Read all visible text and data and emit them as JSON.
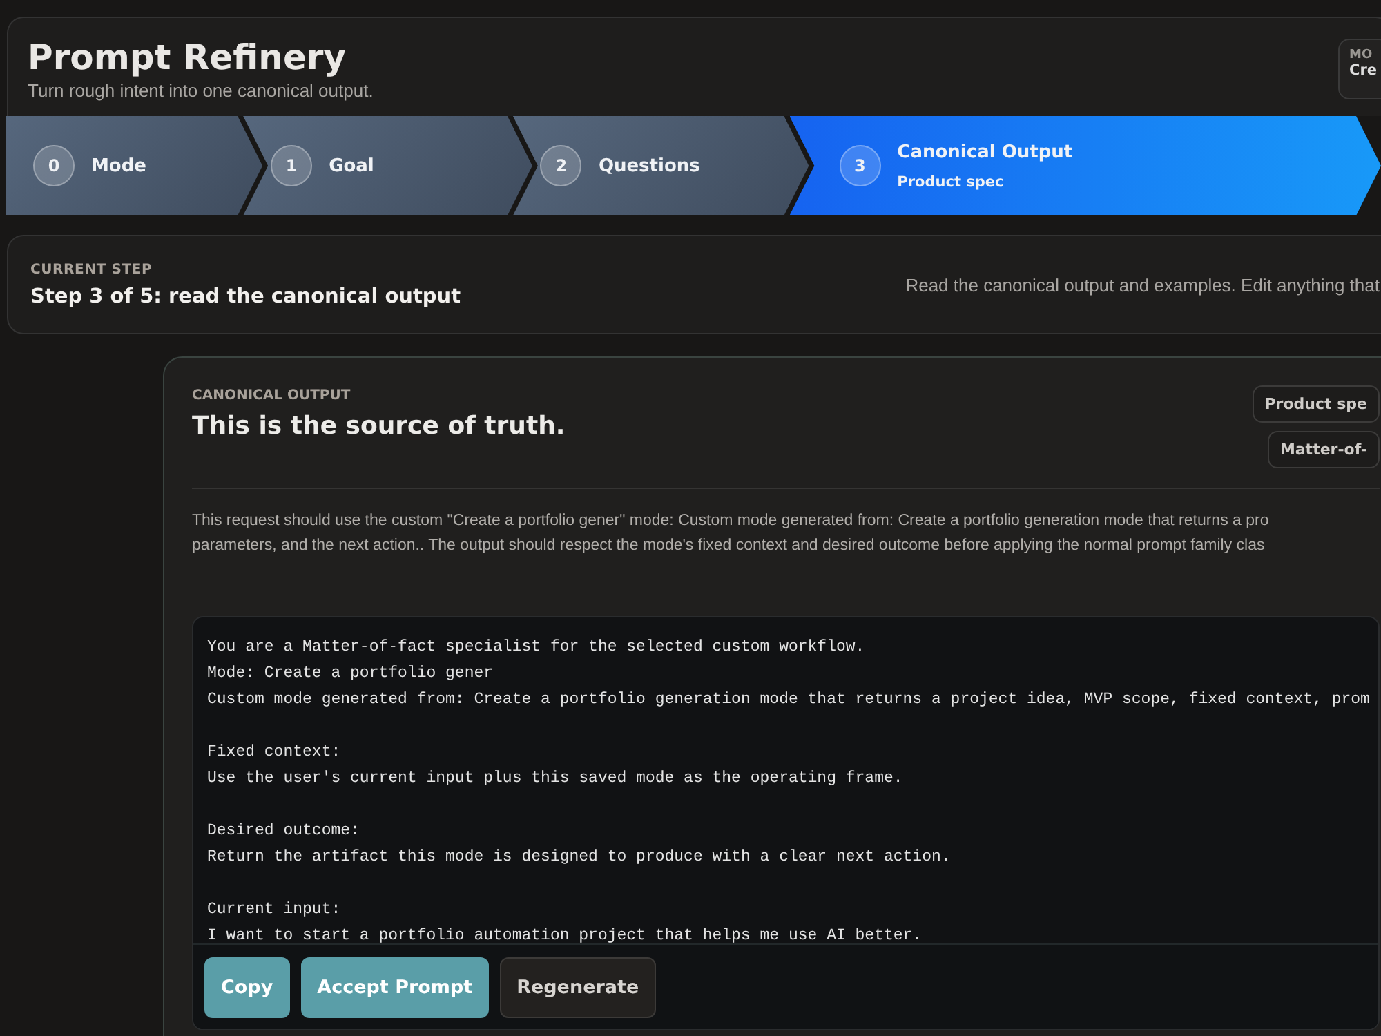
{
  "header": {
    "title": "Prompt Refinery",
    "subtitle": "Turn rough intent into one canonical output.",
    "mode_label": "MO",
    "mode_value": "Cre"
  },
  "steps": [
    {
      "number": "0",
      "label": "Mode",
      "selected": false
    },
    {
      "number": "1",
      "label": "Goal",
      "selected": false
    },
    {
      "number": "2",
      "label": "Questions",
      "selected": false
    },
    {
      "number": "3",
      "label": "Canonical Output",
      "detail": "Product spec",
      "selected": true
    }
  ],
  "current_step": {
    "label": "CURRENT STEP",
    "title": "Step 3 of 5: read the canonical output",
    "hint": "Read the canonical output and examples. Edit anything that"
  },
  "panel": {
    "label": "CANONICAL OUTPUT",
    "title": "This is the source of truth.",
    "tags": [
      "Product spe",
      "Matter-of-"
    ],
    "description_lines": [
      "This request should use the custom \"Create a portfolio gener\" mode: Custom mode generated from: Create a portfolio generation mode that returns a pro",
      "parameters, and the next action.. The output should respect the mode's fixed context and desired outcome before applying the normal prompt family clas"
    ],
    "code_blocks": [
      [
        "You are a Matter-of-fact specialist for the selected custom workflow.",
        "Mode: Create a portfolio gener",
        "Custom mode generated from: Create a portfolio generation mode that returns a project idea, MVP scope, fixed context, prom"
      ],
      [
        "Fixed context:",
        "Use the user's current input plus this saved mode as the operating frame."
      ],
      [
        "Desired outcome:",
        "Return the artifact this mode is designed to produce with a clear next action."
      ],
      [
        "Current input:",
        "I want to start a portfolio automation project that helps me use AI better."
      ]
    ],
    "actions": [
      {
        "label": "Copy",
        "kind": "primary"
      },
      {
        "label": "Accept Prompt",
        "kind": "primary"
      },
      {
        "label": "Regenerate",
        "kind": "secondary"
      }
    ]
  }
}
